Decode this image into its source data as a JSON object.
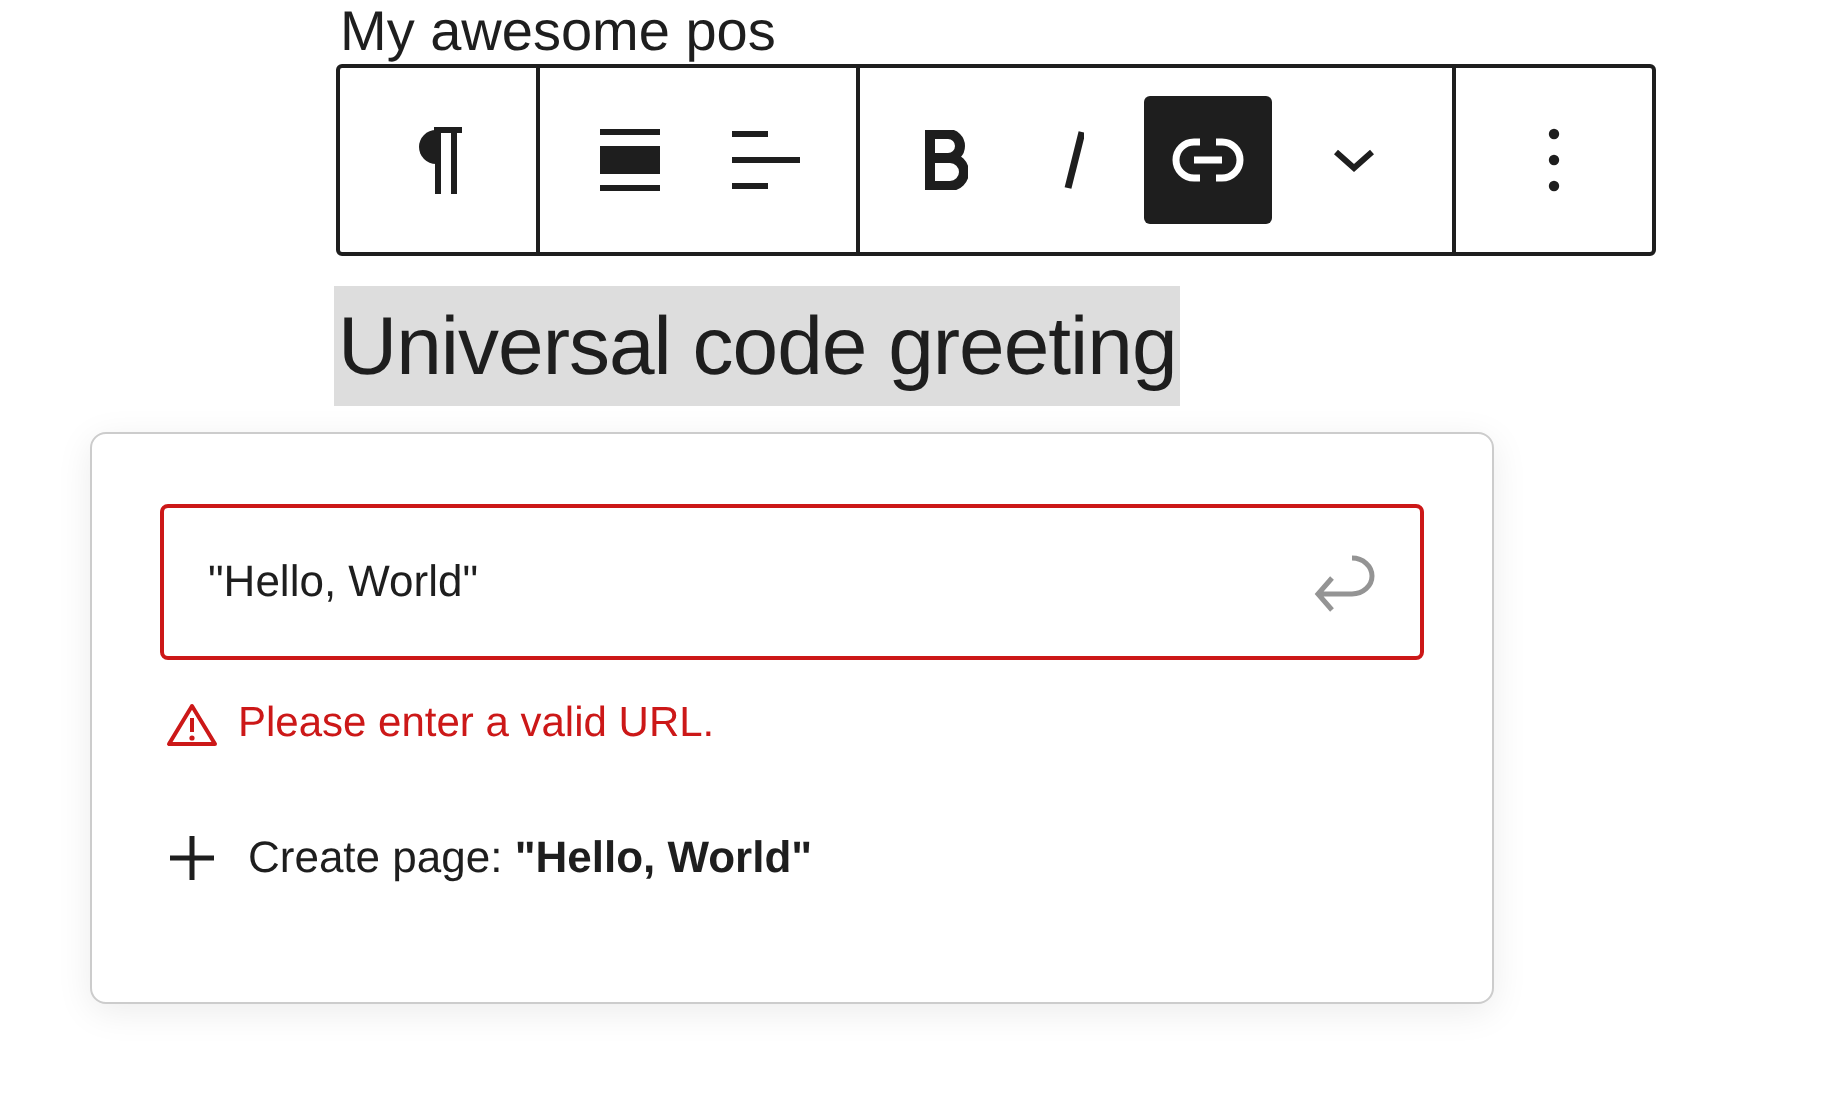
{
  "post_title": "My awesome pos",
  "toolbar": {
    "groups": [
      {
        "buttons": [
          {
            "kind": "paragraph",
            "selected": false
          }
        ]
      },
      {
        "buttons": [
          {
            "kind": "align-wide",
            "selected": false
          },
          {
            "kind": "align-left",
            "selected": false
          }
        ]
      },
      {
        "buttons": [
          {
            "kind": "bold",
            "selected": false
          },
          {
            "kind": "italic",
            "selected": false
          },
          {
            "kind": "link",
            "selected": true
          },
          {
            "kind": "more",
            "selected": false
          }
        ]
      },
      {
        "buttons": [
          {
            "kind": "options",
            "selected": false
          }
        ]
      }
    ]
  },
  "selected_text": "Universal code greeting",
  "link_popover": {
    "url_field": {
      "value": "\"Hello, World\"",
      "invalid": true
    },
    "error": "Please enter a valid URL.",
    "create_page": {
      "label": "Create page: ",
      "name": "\"Hello, World\""
    }
  }
}
